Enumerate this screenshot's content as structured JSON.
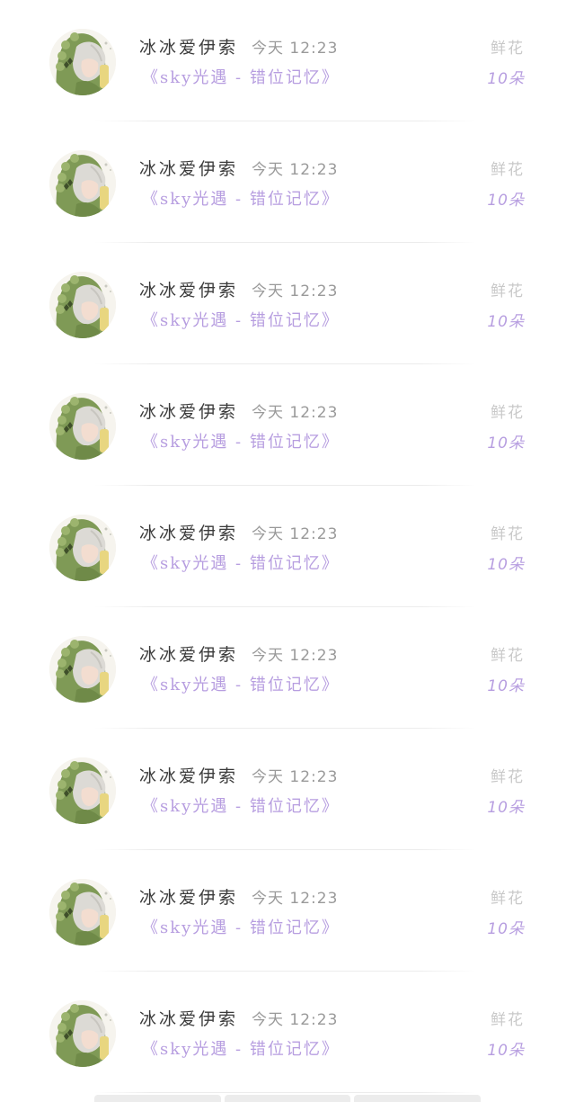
{
  "entries": [
    {
      "user": "冰冰爱伊索",
      "time": "今天 12:23",
      "message": "《sky光遇 - 错位记忆》",
      "gift": "鲜花",
      "count": "10朵"
    },
    {
      "user": "冰冰爱伊索",
      "time": "今天 12:23",
      "message": "《sky光遇 - 错位记忆》",
      "gift": "鲜花",
      "count": "10朵"
    },
    {
      "user": "冰冰爱伊索",
      "time": "今天 12:23",
      "message": "《sky光遇 - 错位记忆》",
      "gift": "鲜花",
      "count": "10朵"
    },
    {
      "user": "冰冰爱伊索",
      "time": "今天 12:23",
      "message": "《sky光遇 - 错位记忆》",
      "gift": "鲜花",
      "count": "10朵"
    },
    {
      "user": "冰冰爱伊索",
      "time": "今天 12:23",
      "message": "《sky光遇 - 错位记忆》",
      "gift": "鲜花",
      "count": "10朵"
    },
    {
      "user": "冰冰爱伊索",
      "time": "今天 12:23",
      "message": "《sky光遇 - 错位记忆》",
      "gift": "鲜花",
      "count": "10朵"
    },
    {
      "user": "冰冰爱伊索",
      "time": "今天 12:23",
      "message": "《sky光遇 - 错位记忆》",
      "gift": "鲜花",
      "count": "10朵"
    },
    {
      "user": "冰冰爱伊索",
      "time": "今天 12:23",
      "message": "《sky光遇 - 错位记忆》",
      "gift": "鲜花",
      "count": "10朵"
    },
    {
      "user": "冰冰爱伊索",
      "time": "今天 12:23",
      "message": "《sky光遇 - 错位记忆》",
      "gift": "鲜花",
      "count": "10朵"
    }
  ],
  "colors": {
    "accent": "#b79ee0",
    "username": "#3b3b3b",
    "muted": "#9a9a9a",
    "gift_label": "#c9c9c9",
    "avatar_hood": "#7f9a56",
    "avatar_hair": "#d9d7d2"
  },
  "icons": {
    "avatar": "avatar-chibi-green-hood"
  }
}
